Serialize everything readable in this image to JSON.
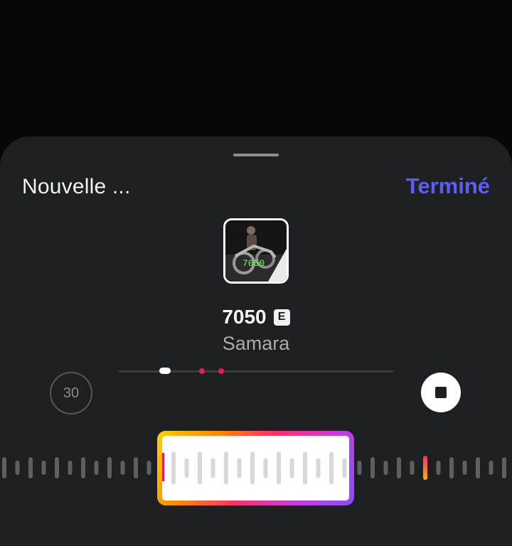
{
  "header": {
    "title": "Nouvelle ...",
    "done_label": "Terminé"
  },
  "track": {
    "name": "7050",
    "explicit_badge": "E",
    "artist": "Samara",
    "artwork_text": "7050"
  },
  "player": {
    "duration_label": "30",
    "progress": 0.17
  },
  "colors": {
    "accent": "#5b5ef0",
    "marker": "#e8195f",
    "sheet": "#1e1f22"
  },
  "icons": {
    "stop": "stop-icon",
    "explicit": "explicit-icon"
  }
}
